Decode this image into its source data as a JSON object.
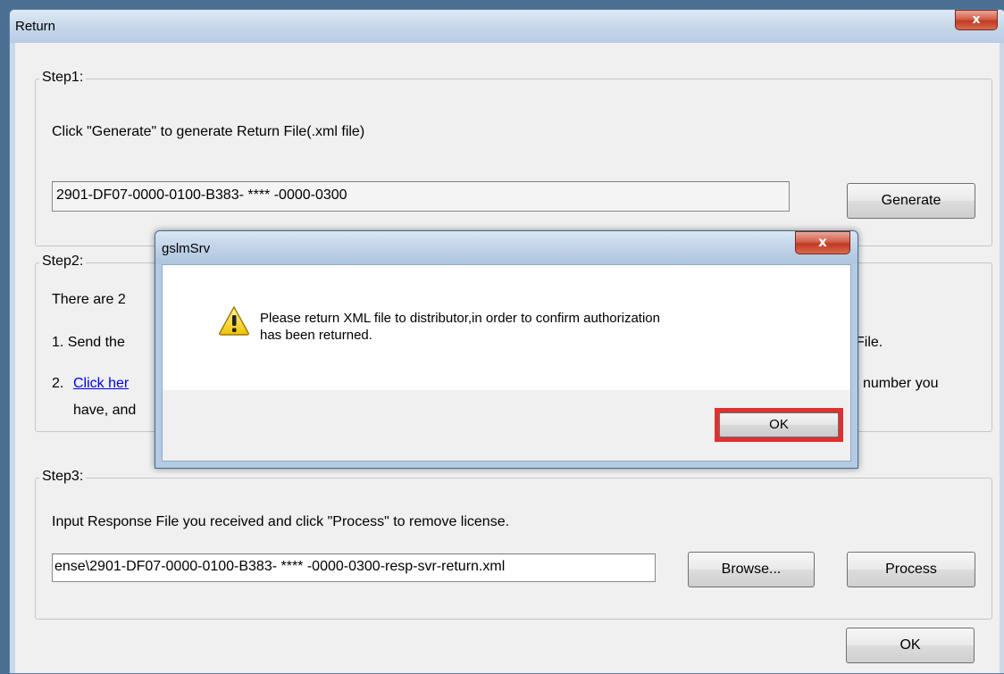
{
  "main_window": {
    "title": "Return",
    "close_glyph": "x",
    "step1": {
      "title": "Step1:",
      "instruction": "Click \"Generate\" to generate Return File(.xml file)",
      "file_value": "2901-DF07-0000-0100-B383-  ****  -0000-0300",
      "generate_label": "Generate"
    },
    "step2": {
      "title": "Step2:",
      "line1": "There are 2",
      "item1_prefix": "1.  Send the",
      "item1_suffix": "File.",
      "item2_prefix": "2.",
      "item2_link": "Click her",
      "item2_suffix": "number you",
      "item2_cont": "have, and"
    },
    "step3": {
      "title": "Step3:",
      "instruction": "Input Response File you received and click \"Process\" to remove license.",
      "file_value": "ense\\2901-DF07-0000-0100-B383-  ****  -0000-0300-resp-svr-return.xml",
      "browse_label": "Browse...",
      "process_label": "Process"
    },
    "ok_label": "OK"
  },
  "dialog": {
    "title": "gslmSrv",
    "close_glyph": "x",
    "icon": "warning-icon",
    "message_line1": "Please return XML file to distributor,in order to confirm authorization",
    "message_line2": "has been returned.",
    "ok_label": "OK",
    "highlight_color": "#e03030"
  }
}
